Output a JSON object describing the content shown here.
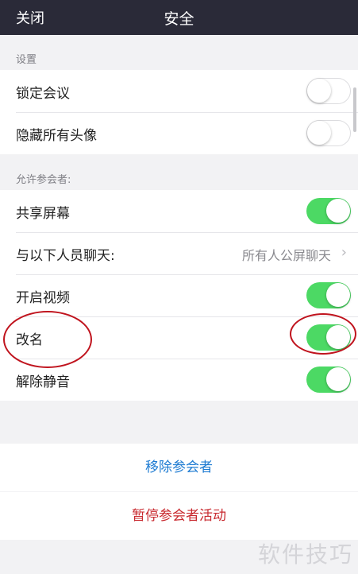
{
  "header": {
    "close_label": "关闭",
    "title": "安全"
  },
  "settings_section": {
    "label": "设置",
    "rows": [
      {
        "label": "锁定会议",
        "toggle_on": false
      },
      {
        "label": "隐藏所有头像",
        "toggle_on": false
      }
    ]
  },
  "participants_section": {
    "label": "允许参会者:",
    "rows": [
      {
        "label": "共享屏幕",
        "toggle_on": true
      },
      {
        "label": "与以下人员聊天:",
        "value": "所有人公屏聊天"
      },
      {
        "label": "开启视频",
        "toggle_on": true
      },
      {
        "label": "改名",
        "toggle_on": true
      },
      {
        "label": "解除静音",
        "toggle_on": true
      }
    ]
  },
  "actions": {
    "remove": "移除参会者",
    "pause": "暂停参会者活动"
  },
  "watermark": "软件技巧",
  "colors": {
    "header_bg": "#2a2a38",
    "toggle_on": "#4cd964",
    "link_blue": "#1e7bd2",
    "danger_red": "#c8282e",
    "annotation_red": "#c0141e"
  }
}
